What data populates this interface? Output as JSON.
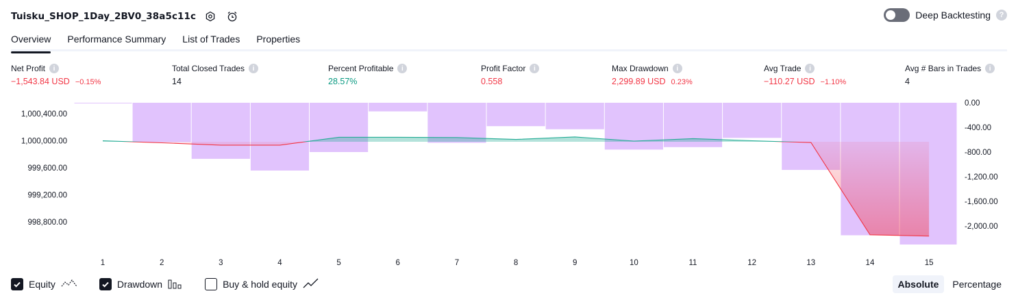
{
  "header": {
    "title": "Tuisku_SHOP_1Day_2BV0_38a5c11c",
    "icons": [
      "settings-icon",
      "alarm-add-icon"
    ],
    "deep_backtesting_label": "Deep Backtesting",
    "deep_backtesting_enabled": false
  },
  "tabs": [
    {
      "label": "Overview",
      "active": true
    },
    {
      "label": "Performance Summary",
      "active": false
    },
    {
      "label": "List of Trades",
      "active": false
    },
    {
      "label": "Properties",
      "active": false
    }
  ],
  "metrics": [
    {
      "label": "Net Profit",
      "value": "−1,543.84 USD",
      "sub": "−0.15%",
      "color": "#f23645"
    },
    {
      "label": "Total Closed Trades",
      "value": "14",
      "sub": "",
      "color": "#131722"
    },
    {
      "label": "Percent Profitable",
      "value": "28.57%",
      "sub": "",
      "color": "#089981"
    },
    {
      "label": "Profit Factor",
      "value": "0.558",
      "sub": "",
      "color": "#f23645"
    },
    {
      "label": "Max Drawdown",
      "value": "2,299.89 USD",
      "sub": "0.23%",
      "color": "#f23645"
    },
    {
      "label": "Avg Trade",
      "value": "−110.27 USD",
      "sub": "−1.10%",
      "color": "#f23645"
    },
    {
      "label": "Avg # Bars in Trades",
      "value": "4",
      "sub": "",
      "color": "#131722"
    }
  ],
  "chart_data": {
    "type": "line",
    "x": [
      1,
      2,
      3,
      4,
      5,
      6,
      7,
      8,
      9,
      10,
      11,
      12,
      13,
      14,
      15
    ],
    "series": [
      {
        "name": "Equity",
        "axis": "left",
        "values": [
          1000000.0,
          999970.0,
          999935.0,
          999935.5,
          1000052.0,
          1000052.0,
          1000048.0,
          1000019.0,
          1000057.0,
          999995.0,
          1000031.0,
          1000000.0,
          999974.0,
          998610.0,
          998590.0
        ]
      },
      {
        "name": "Drawdown",
        "axis": "right",
        "type": "bar",
        "values": [
          -10,
          -640,
          -910,
          -1100,
          -800,
          -140,
          -650,
          -380,
          -430,
          -760,
          -720,
          -570,
          -1090,
          -2150,
          -2300
        ]
      }
    ],
    "left_axis": {
      "ticks": [
        "1,000,400.00",
        "1,000,000.00",
        "999,600.00",
        "999,200.00",
        "998,800.00"
      ]
    },
    "right_axis": {
      "ticks": [
        "0.00",
        "-400.00",
        "-800.00",
        "-1,200.00",
        "-1,600.00",
        "-2,000.00"
      ]
    },
    "x_ticks": [
      "1",
      "2",
      "3",
      "4",
      "5",
      "6",
      "7",
      "8",
      "9",
      "10",
      "11",
      "12",
      "13",
      "14",
      "15"
    ],
    "colors": {
      "equity_up": "#22ab94",
      "equity_down": "#f23645",
      "drawdown_bar": "#e1c3fd"
    }
  },
  "footer": {
    "options": [
      {
        "label": "Equity",
        "checked": true,
        "icon": "equity-line-icon"
      },
      {
        "label": "Drawdown",
        "checked": true,
        "icon": "bar-chart-icon"
      },
      {
        "label": "Buy & hold equity",
        "checked": false,
        "icon": "trend-line-icon"
      }
    ],
    "modes": [
      {
        "label": "Absolute",
        "active": true
      },
      {
        "label": "Percentage",
        "active": false
      }
    ]
  }
}
